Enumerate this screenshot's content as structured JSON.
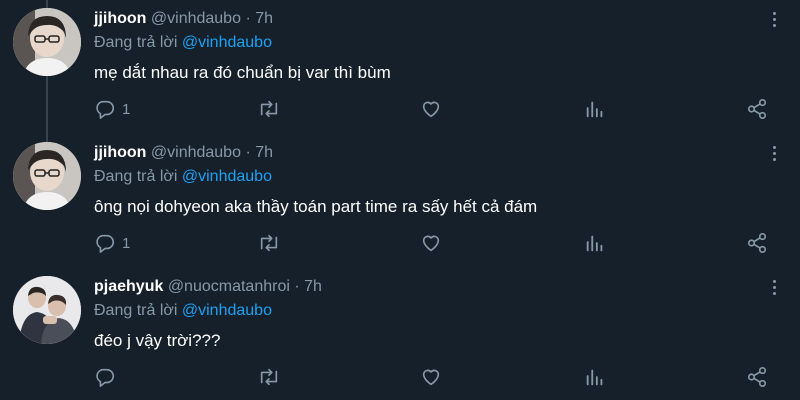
{
  "tweets": [
    {
      "name": "jjihoon",
      "handle": "@vinhdaubo",
      "separator": "·",
      "time": "7h",
      "reply_prefix": "Đang trả lời",
      "reply_to": "@vinhdaubo",
      "text": "mẹ dắt nhau ra đó chuẩn bị var thì bùm",
      "reply_count": "1",
      "avatar_icon": "user-avatar-glasses"
    },
    {
      "name": "jjihoon",
      "handle": "@vinhdaubo",
      "separator": "·",
      "time": "7h",
      "reply_prefix": "Đang trả lời",
      "reply_to": "@vinhdaubo",
      "text": "ông nọi dohyeon aka thầy toán part time ra sấy hết cả đám",
      "reply_count": "1",
      "avatar_icon": "user-avatar-glasses"
    },
    {
      "name": "pjaehyuk",
      "handle": "@nuocmatanhroi",
      "separator": "·",
      "time": "7h",
      "reply_prefix": "Đang trả lời",
      "reply_to": "@vinhdaubo",
      "text": "đéo j vậy trời???",
      "reply_count": "",
      "avatar_icon": "user-avatar-photo"
    }
  ],
  "colors": {
    "background": "#15202b",
    "text": "#ffffff",
    "muted": "#8899a6",
    "link": "#1da1f2",
    "thread_line": "#38444d"
  },
  "icons": [
    "reply-icon",
    "retweet-icon",
    "like-icon",
    "analytics-icon",
    "share-icon",
    "more-icon"
  ]
}
